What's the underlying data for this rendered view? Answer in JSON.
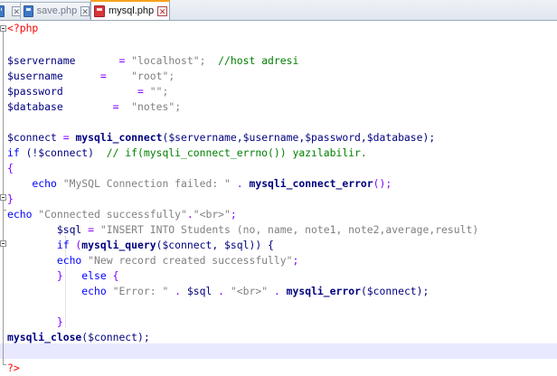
{
  "tabs": [
    {
      "label": "",
      "active": false,
      "icon": "file-blue-icon"
    },
    {
      "label": "save.php",
      "active": false,
      "icon": "file-blue-icon"
    },
    {
      "label": "mysql.php",
      "active": true,
      "icon": "file-red-icon"
    }
  ],
  "colors": {
    "keyword": "#0000ff",
    "variable": "#000080",
    "string": "#808080",
    "comment": "#008000",
    "operator": "#8000ff",
    "php_tag": "#ff0000",
    "caret_line": "#e8e8ff",
    "active_tab_accent": "#f7a21b"
  },
  "code": {
    "line1_open": "<?php",
    "line3_var": "$servername",
    "line3_pad": "       ",
    "line3_eq": "=",
    "line3_val": " \"localhost\";",
    "line3_cmt": "  //host adresi",
    "line4_var": "$username",
    "line4_pad": "      ",
    "line4_eq": "=",
    "line4_val": "    \"root\";",
    "line5_var": "$password",
    "line5_pad": "            ",
    "line5_eq": "=",
    "line5_val": " \"\";",
    "line6_var": "$database",
    "line6_pad": "        ",
    "line6_eq": "=",
    "line6_val": "  \"notes\";",
    "line8_var": "$connect",
    "line8_eq": " = ",
    "line8_fn": "mysqli_connect",
    "line8_args": "($servername,$username,$password,$database);",
    "line9_kw": "if",
    "line9_cond": " (!$connect)",
    "line9_cmt": "  // if(mysqli_connect_errno()) yazılabilir.",
    "line10_brace": "{",
    "line11_echo": "    echo",
    "line11_str": " \"MySQL Connection failed: \"",
    "line11_dot": " . ",
    "line11_fn": "mysqli_connect_error",
    "line11_end": "();",
    "line12_brace": "}",
    "line13_echo": "echo",
    "line13_str": " \"Connected successfully\"",
    "line13_dot": ".",
    "line13_str2": "\"<br>\"",
    "line13_end": ";",
    "line14_var": "        $sql",
    "line14_eq": " = ",
    "line14_str": "\"INSERT INTO Students (no, name, note1, note2,average,result)",
    "line15_kw": "        if",
    "line15_a": " (",
    "line15_fn": "mysqli_query",
    "line15_b": "($connect, $sql)) {",
    "line16_echo": "        echo",
    "line16_str": " \"New record created successfully\"",
    "line16_end": ";",
    "line17_a": "        }",
    "line17_kw": "   else",
    "line17_b": " {",
    "line18_echo": "            echo",
    "line18_str": " \"Error: \"",
    "line18_dot1": " . ",
    "line18_var": "$sql",
    "line18_dot2": " . ",
    "line18_str2": "\"<br>\"",
    "line18_dot3": " . ",
    "line18_fn": "mysqli_error",
    "line18_end": "($connect);",
    "line20_brace": "        }",
    "line21_fn": "mysqli_close",
    "line21_end": "($connect);",
    "line23_close": "?>"
  }
}
